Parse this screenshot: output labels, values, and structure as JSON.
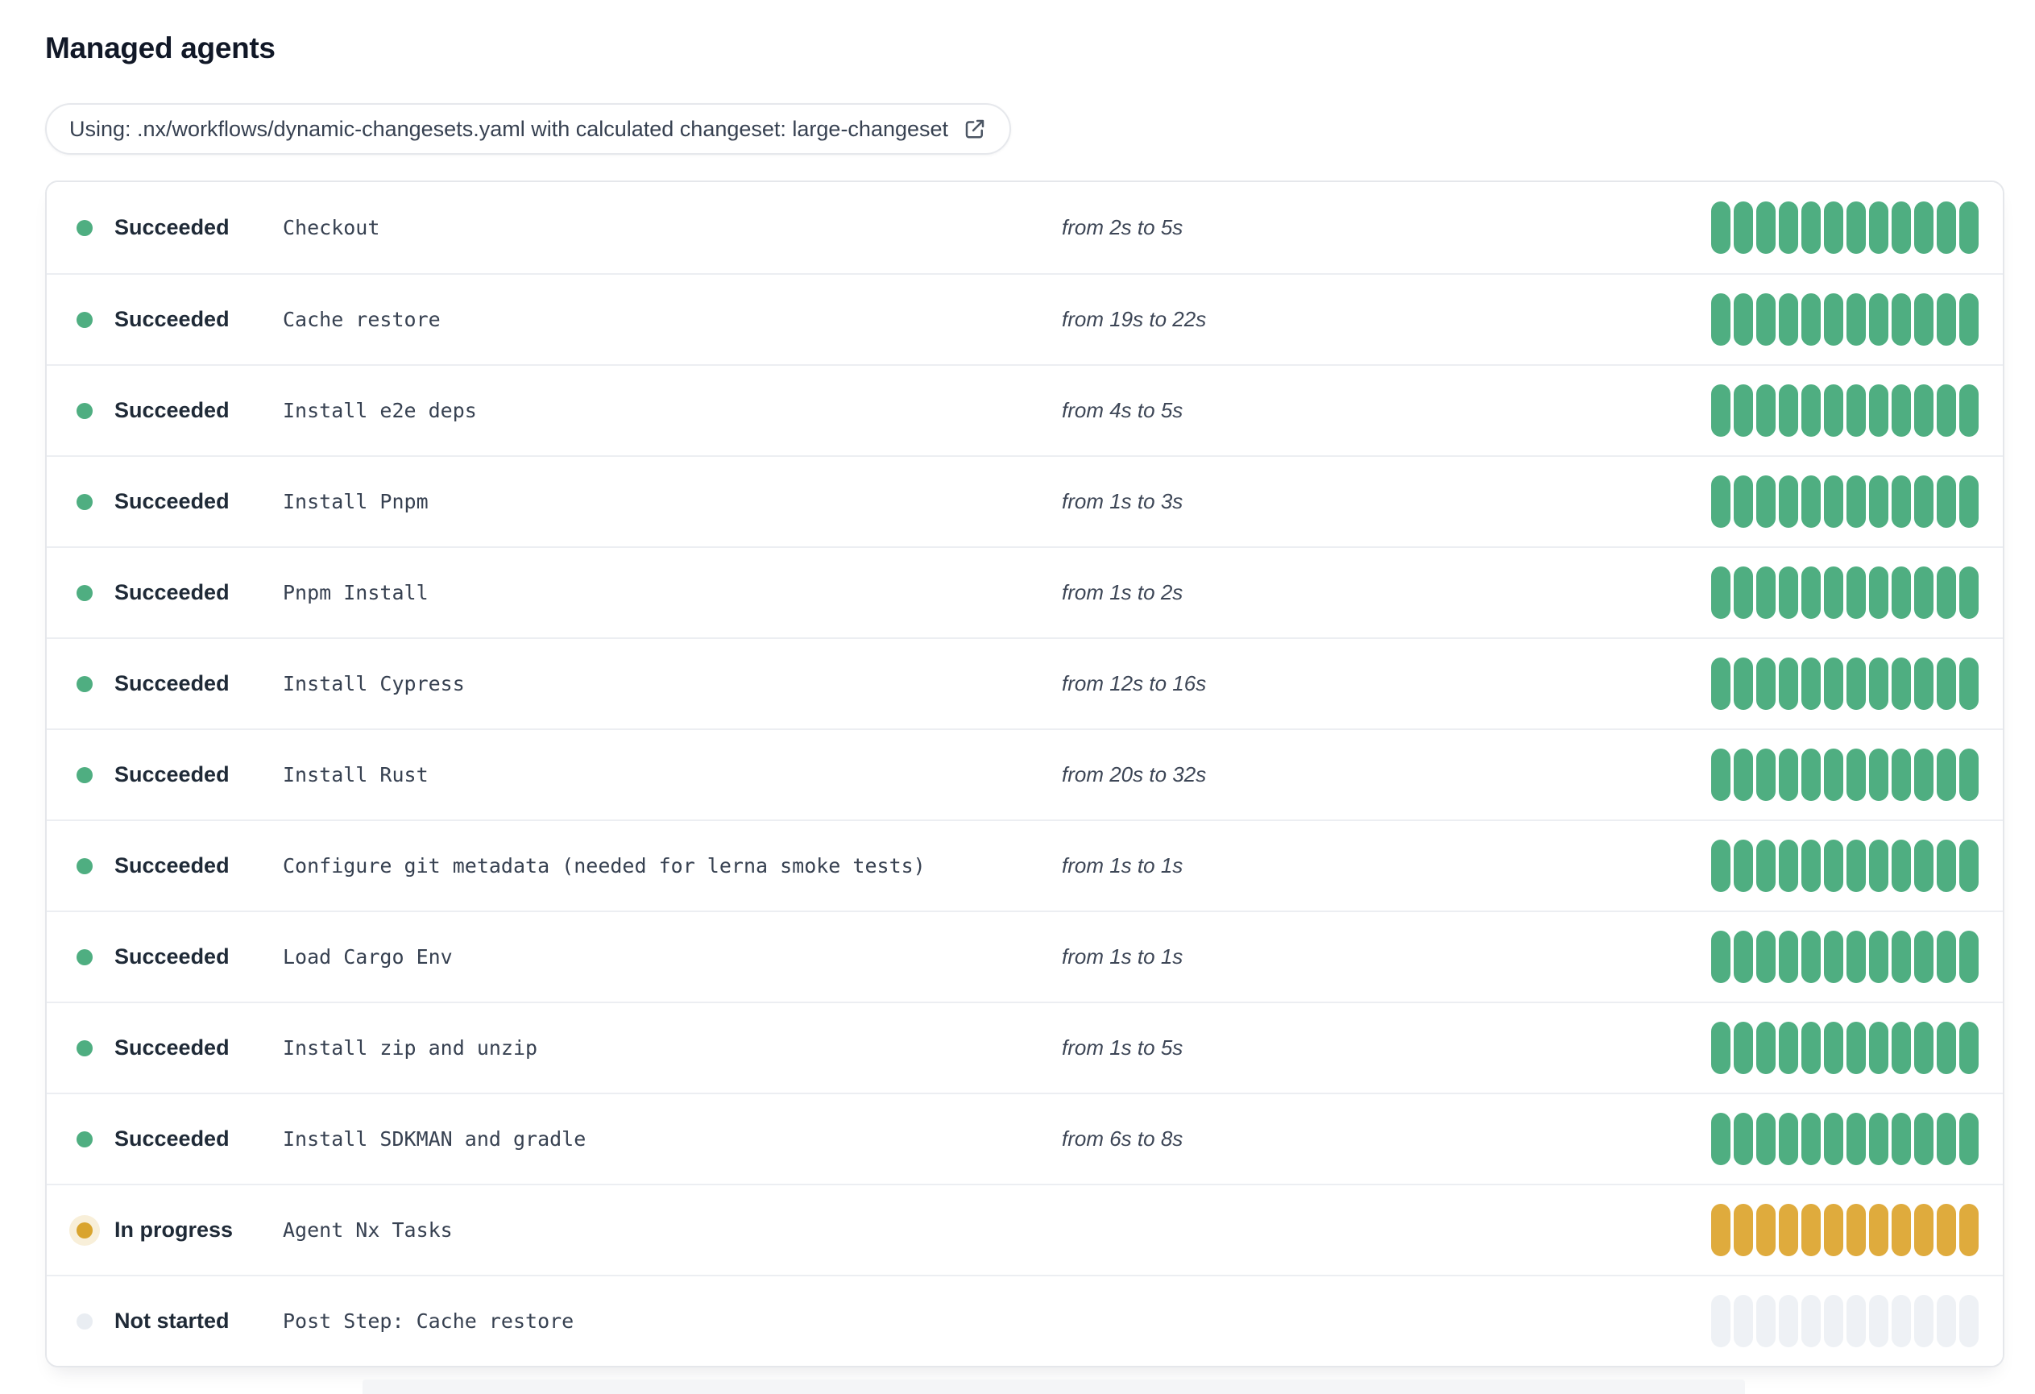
{
  "page": {
    "title": "Managed agents"
  },
  "workflow_badge": {
    "text": "Using: .nx/workflows/dynamic-changesets.yaml with calculated changeset: large-changeset",
    "icon": "external-link-icon"
  },
  "colors": {
    "succeeded": "#4fae81",
    "in_progress": "#dfab3d",
    "in_progress_dot": "#d9a42e",
    "in_progress_halo": "rgba(217,164,46,0.18)",
    "not_started": "#eef1f5",
    "not_started_dot": "#e9edf2"
  },
  "agents": {
    "segments_per_bar": 12,
    "rows": [
      {
        "status": "Succeeded",
        "status_key": "succeeded",
        "step": "Checkout",
        "duration": "from 2s to 5s"
      },
      {
        "status": "Succeeded",
        "status_key": "succeeded",
        "step": "Cache restore",
        "duration": "from 19s to 22s"
      },
      {
        "status": "Succeeded",
        "status_key": "succeeded",
        "step": "Install e2e deps",
        "duration": "from 4s to 5s"
      },
      {
        "status": "Succeeded",
        "status_key": "succeeded",
        "step": "Install Pnpm",
        "duration": "from 1s to 3s"
      },
      {
        "status": "Succeeded",
        "status_key": "succeeded",
        "step": "Pnpm Install",
        "duration": "from 1s to 2s"
      },
      {
        "status": "Succeeded",
        "status_key": "succeeded",
        "step": "Install Cypress",
        "duration": "from 12s to 16s"
      },
      {
        "status": "Succeeded",
        "status_key": "succeeded",
        "step": "Install Rust",
        "duration": "from 20s to 32s"
      },
      {
        "status": "Succeeded",
        "status_key": "succeeded",
        "step": "Configure git metadata (needed for lerna smoke tests)",
        "duration": "from 1s to 1s"
      },
      {
        "status": "Succeeded",
        "status_key": "succeeded",
        "step": "Load Cargo Env",
        "duration": "from 1s to 1s"
      },
      {
        "status": "Succeeded",
        "status_key": "succeeded",
        "step": "Install zip and unzip",
        "duration": "from 1s to 5s"
      },
      {
        "status": "Succeeded",
        "status_key": "succeeded",
        "step": "Install SDKMAN and gradle",
        "duration": "from 6s to 8s"
      },
      {
        "status": "In progress",
        "status_key": "in_progress",
        "step": "Agent Nx Tasks",
        "duration": ""
      },
      {
        "status": "Not started",
        "status_key": "not_started",
        "step": "Post Step: Cache restore",
        "duration": ""
      }
    ]
  }
}
